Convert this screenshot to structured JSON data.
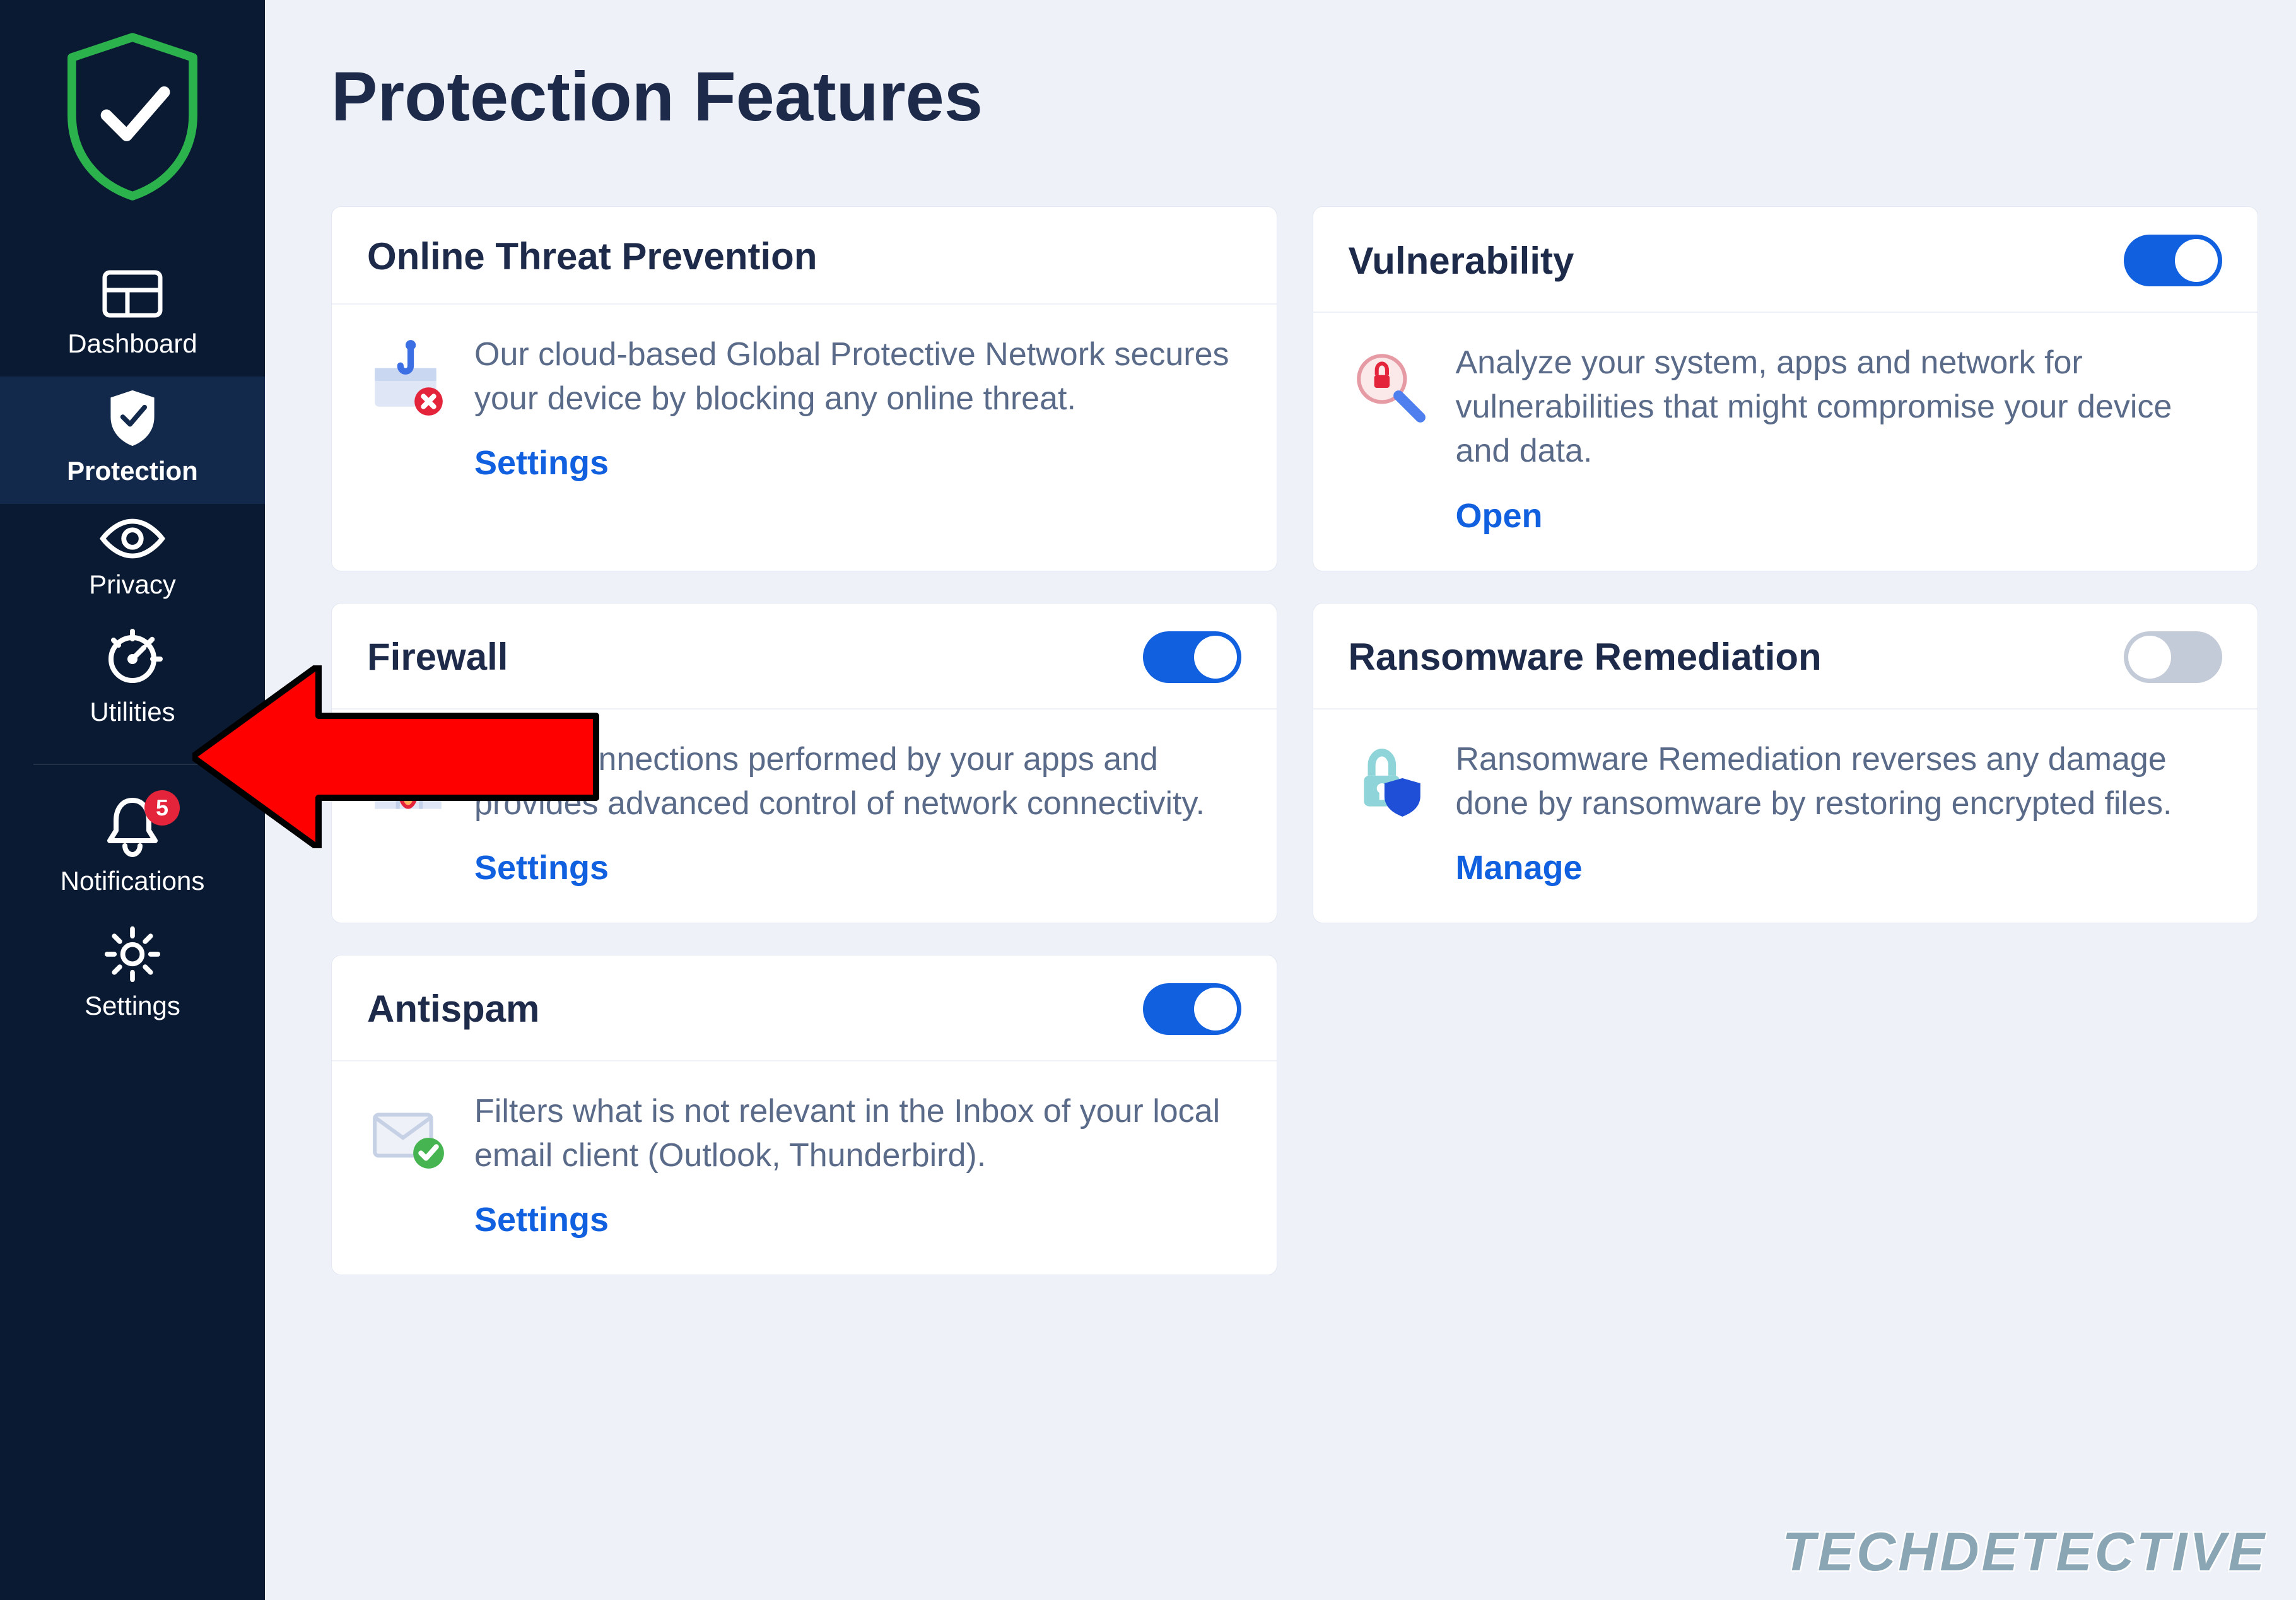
{
  "page": {
    "title": "Protection Features",
    "watermark": "TECHDETECTIVE"
  },
  "sidebar": {
    "items": [
      {
        "id": "dashboard",
        "label": "Dashboard",
        "active": false
      },
      {
        "id": "protection",
        "label": "Protection",
        "active": true
      },
      {
        "id": "privacy",
        "label": "Privacy",
        "active": false
      },
      {
        "id": "utilities",
        "label": "Utilities",
        "active": false
      },
      {
        "id": "notifications",
        "label": "Notifications",
        "active": false,
        "badge": "5"
      },
      {
        "id": "settings",
        "label": "Settings",
        "active": false
      }
    ]
  },
  "cards": {
    "otp": {
      "title": "Online Threat Prevention",
      "desc": "Our cloud-based Global Protective Network secures your device by blocking any online threat.",
      "link": "Settings",
      "toggle": null
    },
    "vuln": {
      "title": "Vulnerability",
      "desc": "Analyze your system, apps and network for vulnerabilities that might compromise your device and data.",
      "link": "Open",
      "toggle": true
    },
    "fw": {
      "title": "Firewall",
      "desc": "nitors connections performed by your apps and provides advanced control of network connectivity.",
      "link": "Settings",
      "toggle": true
    },
    "rr": {
      "title": "Ransomware Remediation",
      "desc": "Ransomware Remediation reverses any damage done by ransomware by restoring encrypted files.",
      "link": "Manage",
      "toggle": false
    },
    "as": {
      "title": "Antispam",
      "desc": "Filters what is not relevant in the Inbox of your local email client (Outlook, Thunderbird).",
      "link": "Settings",
      "toggle": true
    }
  },
  "annotation": {
    "target": "privacy"
  }
}
